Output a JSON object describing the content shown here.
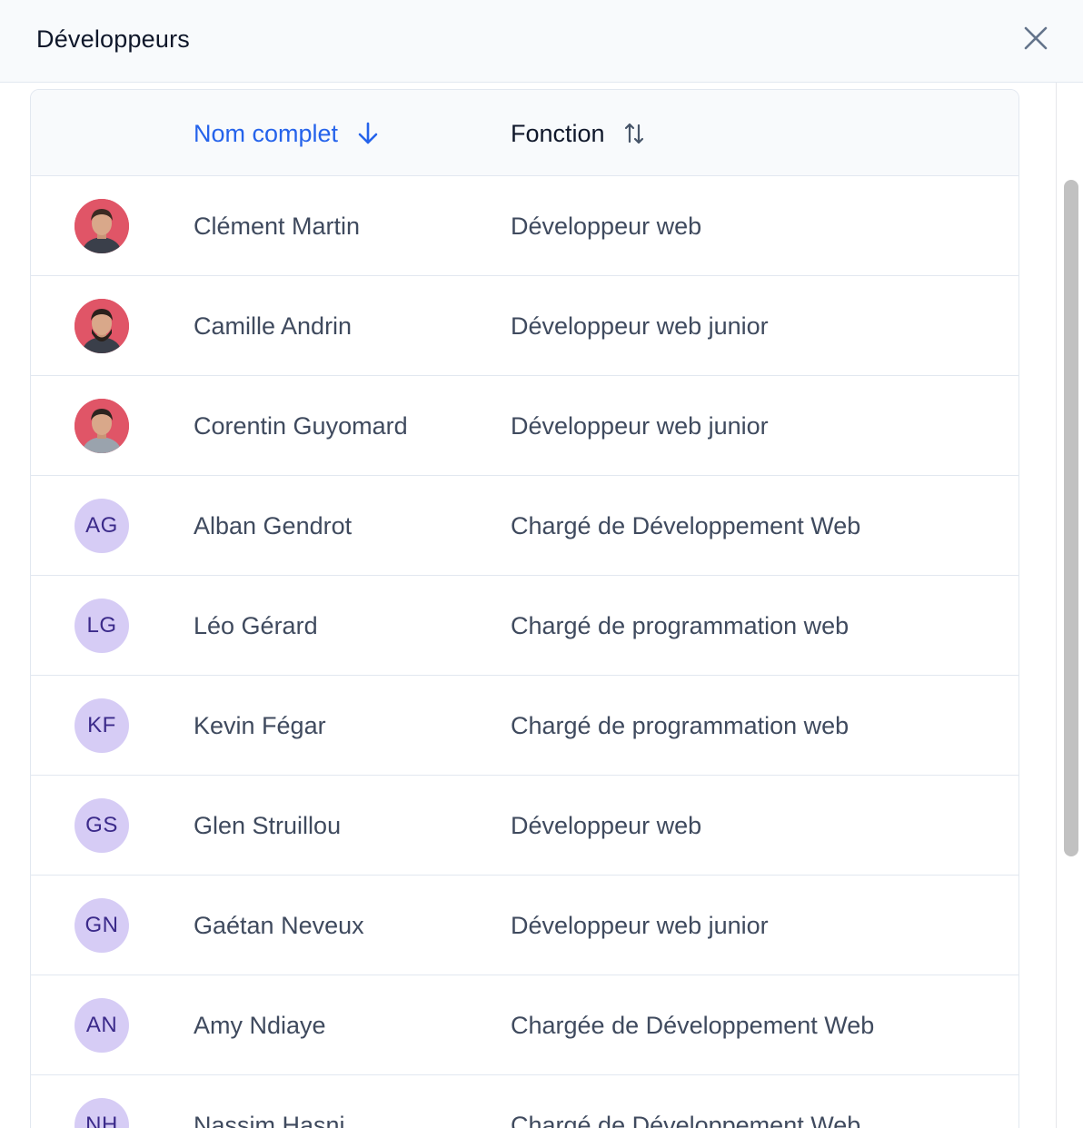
{
  "modal": {
    "title": "Développeurs"
  },
  "table": {
    "columns": [
      {
        "label": "Nom complet",
        "sort": "descending",
        "active": true
      },
      {
        "label": "Fonction",
        "sort": "sortable",
        "active": false
      }
    ],
    "rows": [
      {
        "avatar_type": "photo",
        "initials": "",
        "name": "Clément Martin",
        "role": "Développeur web"
      },
      {
        "avatar_type": "photo",
        "initials": "",
        "name": "Camille Andrin",
        "role": "Développeur web junior"
      },
      {
        "avatar_type": "photo",
        "initials": "",
        "name": "Corentin Guyomard",
        "role": "Développeur web junior"
      },
      {
        "avatar_type": "initials",
        "initials": "AG",
        "name": "Alban Gendrot",
        "role": "Chargé de Développement Web"
      },
      {
        "avatar_type": "initials",
        "initials": "LG",
        "name": "Léo Gérard",
        "role": "Chargé de programmation web"
      },
      {
        "avatar_type": "initials",
        "initials": "KF",
        "name": "Kevin Fégar",
        "role": "Chargé de programmation web"
      },
      {
        "avatar_type": "initials",
        "initials": "GS",
        "name": "Glen Struillou",
        "role": "Développeur web"
      },
      {
        "avatar_type": "initials",
        "initials": "GN",
        "name": "Gaétan Neveux",
        "role": "Développeur web junior"
      },
      {
        "avatar_type": "initials",
        "initials": "AN",
        "name": "Amy Ndiaye",
        "role": "Chargée de Développement Web"
      },
      {
        "avatar_type": "initials",
        "initials": "NH",
        "name": "Nassim Hasni",
        "role": "Chargé de Développement Web"
      }
    ]
  },
  "colors": {
    "accent": "#2563eb",
    "avatar_initials_bg": "#d6ccf5",
    "avatar_initials_text": "#3b2a8a",
    "avatar_photo_bg": "#e05567"
  },
  "icons": {
    "close": "close-icon",
    "sort_active": "arrow-down-icon",
    "sort_inactive": "sort-arrows-icon",
    "avatar_photo": "person-photo-icon"
  }
}
